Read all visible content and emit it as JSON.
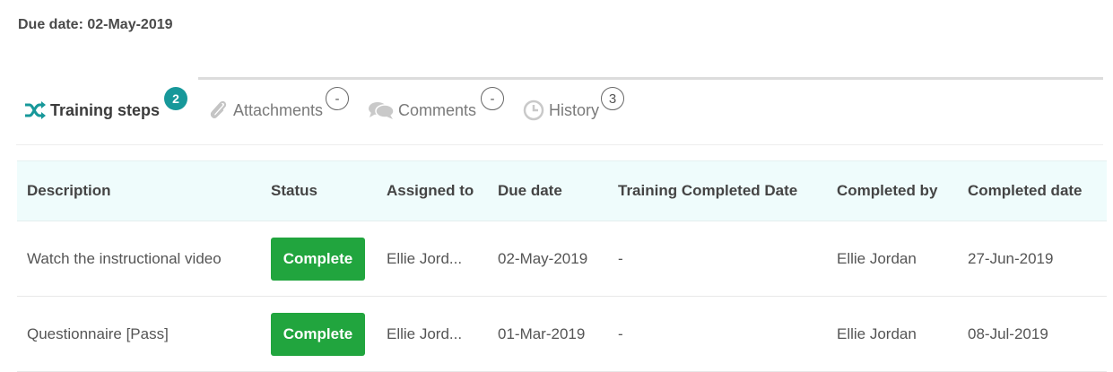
{
  "due_date_label": "Due date: 02-May-2019",
  "tabs": [
    {
      "label": "Training steps",
      "badge": "2",
      "icon": "shuffle-icon"
    },
    {
      "label": "Attachments",
      "badge": "-",
      "icon": "paperclip-icon"
    },
    {
      "label": "Comments",
      "badge": "-",
      "icon": "comment-icon"
    },
    {
      "label": "History",
      "badge": "3",
      "icon": "clock-icon"
    }
  ],
  "table": {
    "headers": [
      "Description",
      "Status",
      "Assigned to",
      "Due date",
      "Training Completed Date",
      "Completed by",
      "Completed date"
    ],
    "rows": [
      {
        "description": "Watch the instructional video",
        "status": "Complete",
        "assigned_to": "Ellie Jord...",
        "due_date": "02-May-2019",
        "training_completed_date": "-",
        "completed_by": "Ellie Jordan",
        "completed_date": "27-Jun-2019"
      },
      {
        "description": "Questionnaire [Pass]",
        "status": "Complete",
        "assigned_to": "Ellie Jord...",
        "due_date": "01-Mar-2019",
        "training_completed_date": "-",
        "completed_by": "Ellie Jordan",
        "completed_date": "08-Jul-2019"
      }
    ]
  },
  "colors": {
    "accent": "#17989a",
    "status_complete": "#21a53e",
    "header_bg": "#effcfc"
  }
}
